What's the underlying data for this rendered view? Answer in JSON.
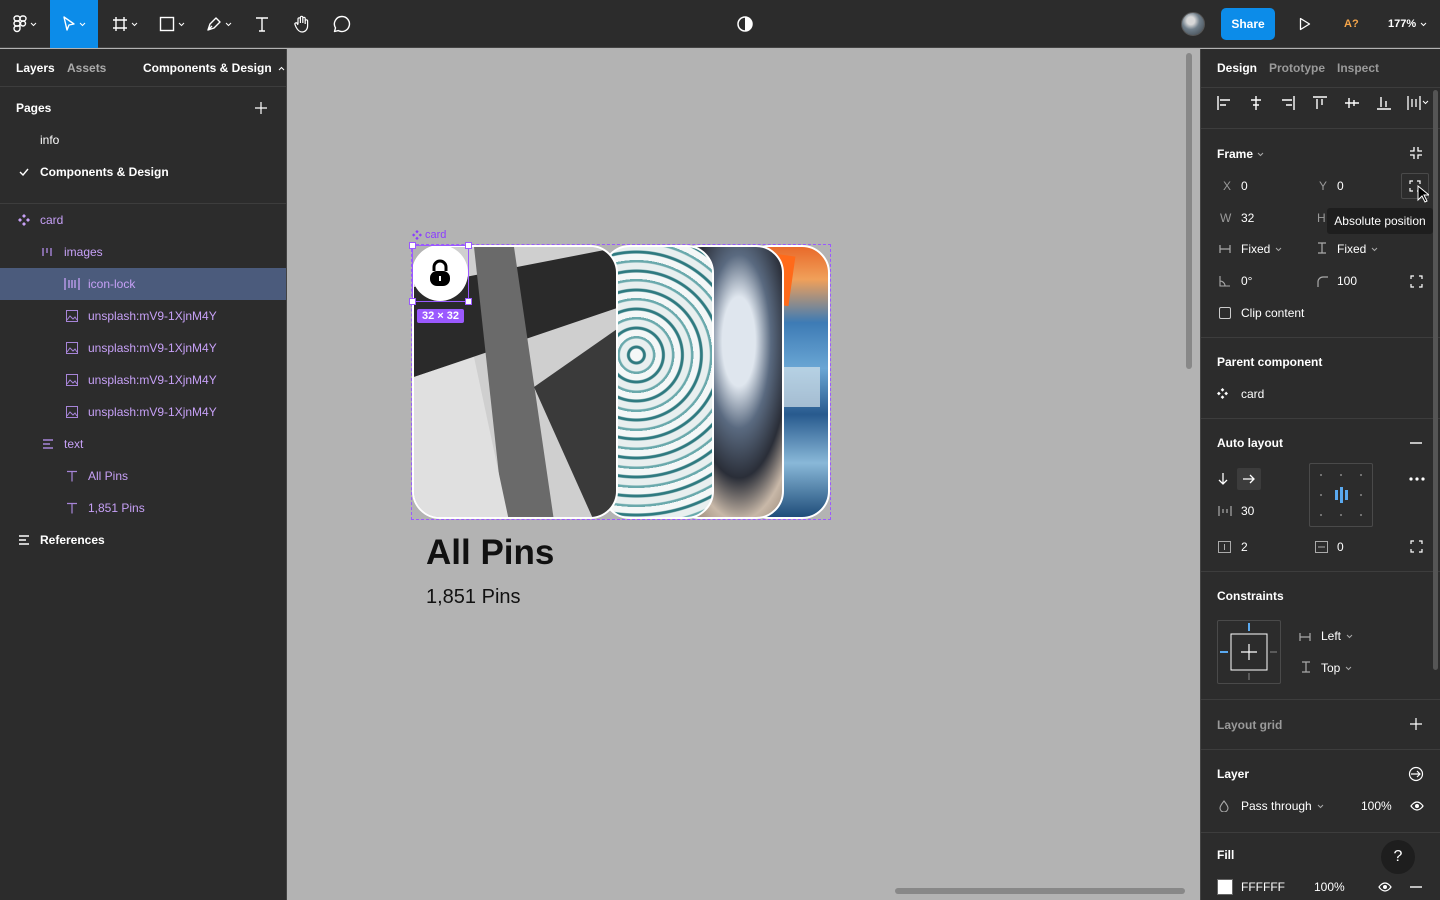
{
  "toolbar": {
    "share_label": "Share",
    "missing_fonts": "A?",
    "zoom": "177%"
  },
  "left_panel": {
    "tabs": [
      "Layers",
      "Assets"
    ],
    "page_dropdown": "Components & Design",
    "pages_heading": "Pages",
    "pages": [
      "info",
      "Components & Design"
    ],
    "layers": [
      {
        "name": "card"
      },
      {
        "name": "images"
      },
      {
        "name": "icon-lock"
      },
      {
        "name": "unsplash:mV9-1XjnM4Y"
      },
      {
        "name": "unsplash:mV9-1XjnM4Y"
      },
      {
        "name": "unsplash:mV9-1XjnM4Y"
      },
      {
        "name": "unsplash:mV9-1XjnM4Y"
      },
      {
        "name": "text"
      },
      {
        "name": "All Pins"
      },
      {
        "name": "1,851 Pins"
      },
      {
        "name": "References"
      }
    ]
  },
  "canvas": {
    "frame_label": "card",
    "size_badge": "32 × 32",
    "title": "All Pins",
    "subtitle": "1,851 Pins"
  },
  "right_panel": {
    "tabs": [
      "Design",
      "Prototype",
      "Inspect"
    ],
    "frame_heading": "Frame",
    "x_label": "X",
    "x_value": "0",
    "y_label": "Y",
    "y_value": "0",
    "w_label": "W",
    "w_value": "32",
    "h_label": "H",
    "tooltip": "Absolute position",
    "h_resize": "Fixed",
    "v_resize": "Fixed",
    "rotation": "0°",
    "radius": "100",
    "clip_content": "Clip content",
    "parent_component_heading": "Parent component",
    "parent_component": "card",
    "auto_layout_heading": "Auto layout",
    "spacing": "30",
    "padding_h": "2",
    "padding_v": "0",
    "constraints_heading": "Constraints",
    "constraint_h": "Left",
    "constraint_v": "Top",
    "layout_grid_heading": "Layout grid",
    "layer_heading": "Layer",
    "blend_mode": "Pass through",
    "layer_opacity": "100%",
    "fill_heading": "Fill",
    "fill_hex": "FFFFFF",
    "fill_opacity": "100%",
    "help": "?"
  },
  "colors": {
    "accent": "#0c8ce9",
    "selection": "#9b59ff",
    "component": "#c6a0f6"
  }
}
